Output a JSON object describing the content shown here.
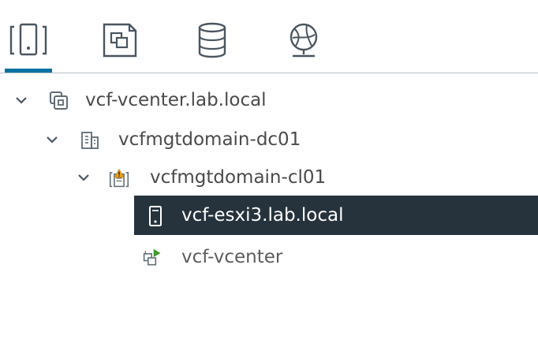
{
  "tabs": [
    {
      "name": "hosts-and-clusters",
      "icon": "hosts-and-clusters-icon",
      "active": true
    },
    {
      "name": "vms-and-templates",
      "icon": "vms-and-templates-icon",
      "active": false
    },
    {
      "name": "storage",
      "icon": "storage-icon",
      "active": false
    },
    {
      "name": "networking",
      "icon": "networking-icon",
      "active": false
    }
  ],
  "tree": {
    "vcenter": {
      "label": "vcf-vcenter.lab.local",
      "icon": "vcenter-icon",
      "expanded": true
    },
    "datacenter": {
      "label": "vcfmgtdomain-dc01",
      "icon": "datacenter-icon",
      "expanded": true
    },
    "cluster": {
      "label": "vcfmgtdomain-cl01",
      "icon": "cluster-warning-icon",
      "expanded": true
    },
    "host": {
      "label": "vcf-esxi3.lab.local",
      "icon": "host-icon",
      "selected": true
    },
    "vm": {
      "label": "vcf-vcenter",
      "icon": "vm-powered-on-icon"
    }
  },
  "colors": {
    "accent": "#0072a3",
    "selected_bg": "#26333d",
    "warning": "#e8a317",
    "vm_running": "#3d9a2b"
  }
}
